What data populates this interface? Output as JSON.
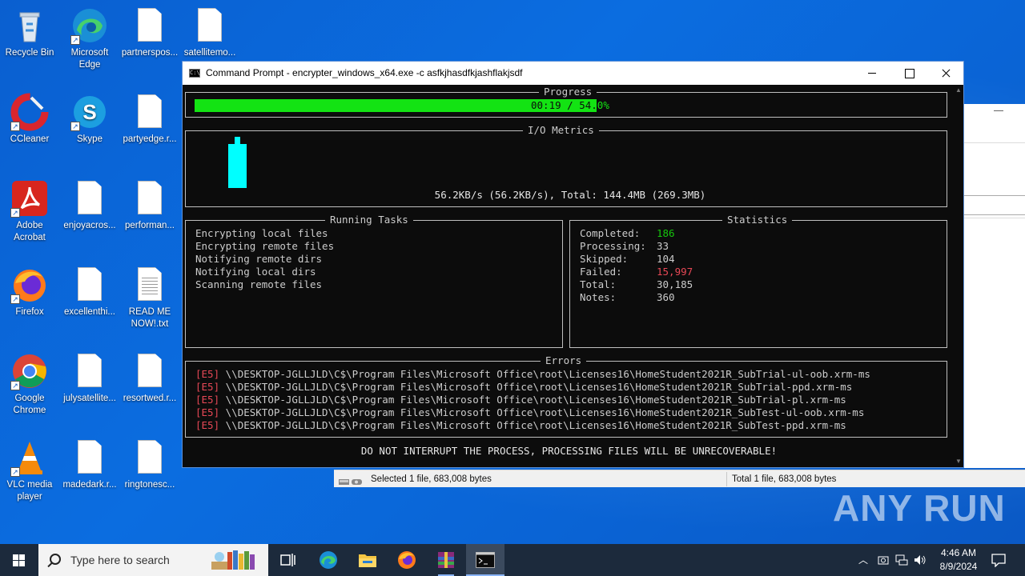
{
  "desktop": {
    "icons": [
      {
        "label": "Recycle Bin",
        "icon": "recycle-bin-icon"
      },
      {
        "label": "Microsoft Edge",
        "icon": "edge-icon"
      },
      {
        "label": "partnerspos...",
        "icon": "file-icon"
      },
      {
        "label": "satellitemo...",
        "icon": "file-icon"
      },
      {
        "label": "CCleaner",
        "icon": "ccleaner-icon"
      },
      {
        "label": "Skype",
        "icon": "skype-icon"
      },
      {
        "label": "partyedge.r...",
        "icon": "file-icon"
      },
      {
        "label": "Adobe Acrobat",
        "icon": "acrobat-icon"
      },
      {
        "label": "enjoyacros...",
        "icon": "file-icon"
      },
      {
        "label": "performan...",
        "icon": "file-icon"
      },
      {
        "label": "Firefox",
        "icon": "firefox-icon"
      },
      {
        "label": "excellenthi...",
        "icon": "file-icon"
      },
      {
        "label": "READ ME NOW!.txt",
        "icon": "text-file-icon"
      },
      {
        "label": "Google Chrome",
        "icon": "chrome-icon"
      },
      {
        "label": "julysatellite...",
        "icon": "file-icon"
      },
      {
        "label": "resortwed.r...",
        "icon": "file-icon"
      },
      {
        "label": "VLC media player",
        "icon": "vlc-icon"
      },
      {
        "label": "madedark.r...",
        "icon": "file-icon"
      },
      {
        "label": "ringtonesc...",
        "icon": "file-icon"
      }
    ]
  },
  "console": {
    "title": "Command Prompt - encrypter_windows_x64.exe  -c asfkjhasdfkjashflakjsdf",
    "progress": {
      "title": "Progress",
      "fraction": 0.54,
      "time_text": "00:19 / 54.",
      "tail_text": "0%"
    },
    "io": {
      "title": "I/O Metrics",
      "summary": "56.2KB/s (56.2KB/s), Total: 144.4MB (269.3MB)"
    },
    "tasks": {
      "title": "Running Tasks",
      "items": [
        "Encrypting local files",
        "Encrypting remote files",
        "Notifying remote dirs",
        "Notifying local dirs",
        "Scanning remote files"
      ]
    },
    "stats": {
      "title": "Statistics",
      "completed_label": "Completed:",
      "completed_value": "186",
      "processing_label": "Processing:",
      "processing_value": "33",
      "skipped_label": "Skipped:",
      "skipped_value": "104",
      "failed_label": "Failed:",
      "failed_value": "15,997",
      "total_label": "Total:",
      "total_value": "30,185",
      "notes_label": "Notes:",
      "notes_value": "360"
    },
    "errors": {
      "title": "Errors",
      "code": "[E5]",
      "lines": [
        "\\\\DESKTOP-JGLLJLD\\C$\\Program Files\\Microsoft Office\\root\\Licenses16\\HomeStudent2021R_SubTrial-ul-oob.xrm-ms",
        "\\\\DESKTOP-JGLLJLD\\C$\\Program Files\\Microsoft Office\\root\\Licenses16\\HomeStudent2021R_SubTrial-ppd.xrm-ms",
        "\\\\DESKTOP-JGLLJLD\\C$\\Program Files\\Microsoft Office\\root\\Licenses16\\HomeStudent2021R_SubTrial-pl.xrm-ms",
        "\\\\DESKTOP-JGLLJLD\\C$\\Program Files\\Microsoft Office\\root\\Licenses16\\HomeStudent2021R_SubTest-ul-oob.xrm-ms",
        "\\\\DESKTOP-JGLLJLD\\C$\\Program Files\\Microsoft Office\\root\\Licenses16\\HomeStudent2021R_SubTest-ppd.xrm-ms"
      ]
    },
    "warning": "DO NOT INTERRUPT THE PROCESS, PROCESSING FILES WILL BE UNRECOVERABLE!"
  },
  "explorer_status": {
    "selected": "Selected 1 file, 683,008 bytes",
    "total": "Total 1 file, 683,008 bytes"
  },
  "taskbar": {
    "search_placeholder": "Type here to search",
    "apps": [
      "task-view-icon",
      "edge-icon",
      "file-explorer-icon",
      "firefox-icon",
      "winrar-icon",
      "command-prompt-icon"
    ],
    "time": "4:46 AM",
    "date": "8/9/2024"
  },
  "watermark": "ANY RUN",
  "colors": {
    "progress_green": "#13e313",
    "io_cyan": "#00ffff",
    "ok_green": "#16c60c",
    "error_red": "#e74856"
  }
}
